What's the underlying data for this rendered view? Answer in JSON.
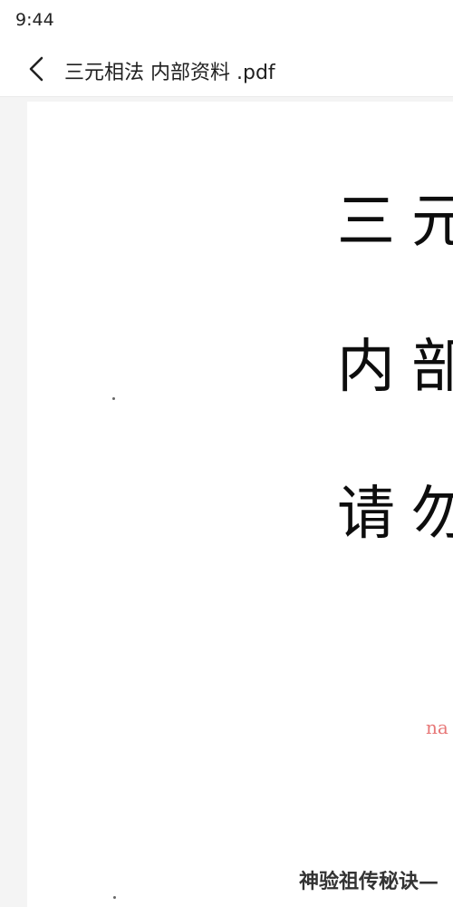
{
  "status_bar": {
    "time": "9:44"
  },
  "app_bar": {
    "back_icon": "chevron-left-icon",
    "title": "三元相法 内部资料 .pdf"
  },
  "page": {
    "cover_lines": [
      "三元",
      "内部",
      "请勿"
    ],
    "watermark": "na",
    "subtitle": "神验祖传秘诀—"
  },
  "colors": {
    "background": "#ffffff",
    "viewer_background": "#f4f4f4",
    "watermark": "#e77777",
    "text": "#1f1f1f"
  }
}
